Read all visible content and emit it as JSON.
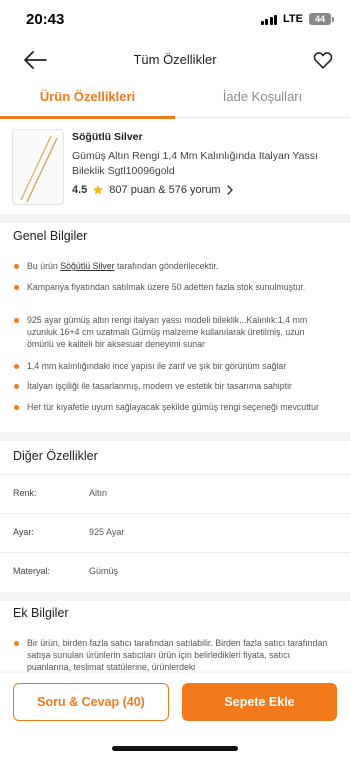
{
  "status_bar": {
    "time": "20:43",
    "network": "LTE",
    "battery": "44"
  },
  "header": {
    "title": "Tüm Özellikler"
  },
  "tabs": [
    {
      "label": "Ürün Özellikleri",
      "active": true
    },
    {
      "label": "İade Koşulları",
      "active": false
    }
  ],
  "product": {
    "brand": "Söğütlü Silver",
    "name": "Gümüş Altın Rengi 1,4 Mm Kalınlığında Italyan Yassı Bileklik Sgtl10096gold",
    "rating": "4.5",
    "rating_text": "807 puan & 576 yorum"
  },
  "general_info": {
    "title": "Genel Bilgiler",
    "bullet1_pre": "Bu ürün ",
    "bullet1_link": "Söğütlü Silver",
    "bullet1_post": " tarafından gönderilecektir.",
    "items": [
      "Kampanya fiyatından satılmak üzere 50 adetten fazla stok sunulmuştur.",
      "925 ayar gümüş altın rengi italyan yassı modeli bileklik...Kalınlık:1,4 mm uzunluk 16+4 cm uzatmalı Gümüş malzeme kullanılarak üretilmiş, uzun ömürlü ve kaliteli bir aksesuar deneyimi sunar",
      "1,4 mm kalınlığındaki ince yapısı ile zarif ve şık bir görünüm sağlar",
      "İtalyan işçiliği ile tasarlanmış, modern ve estetik bir tasarıma sahiptir",
      "Her tür kıyafetle uyum sağlayacak şekilde gümüş rengi seçeneği mevcuttur"
    ]
  },
  "other_features": {
    "title": "Diğer Özellikler",
    "rows": [
      {
        "key": "Renk:",
        "value": "Altın"
      },
      {
        "key": "Ayar:",
        "value": "925 Ayar"
      },
      {
        "key": "Materyal:",
        "value": "Gümüş"
      }
    ]
  },
  "extra_info": {
    "title": "Ek Bilgiler",
    "text": "Bir ürün, birden fazla satıcı tarafından satılabilir. Birden fazla satıcı tarafından satışa sunulan ürünlerin satıcıları ürün için belirledikleri fiyata, satıcı puanlarına, teslimat statülerine, ürünlerdeki"
  },
  "bottom": {
    "qa_label": "Soru & Cevap (40)",
    "cart_label": "Sepete Ekle"
  },
  "colors": {
    "accent": "#f27a1a",
    "star": "#f5b800"
  },
  "icons": {
    "back": "arrow-left-icon",
    "favorite": "heart-icon",
    "star": "star-icon",
    "chevron": "chevron-right-icon"
  }
}
